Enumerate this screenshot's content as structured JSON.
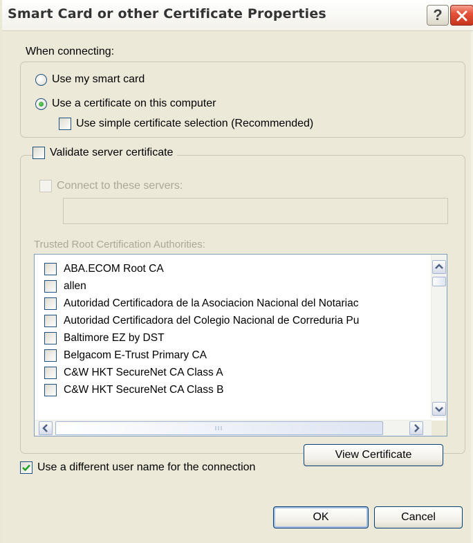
{
  "window": {
    "title": "Smart Card or other Certificate Properties",
    "help_label": "?"
  },
  "when_connecting": {
    "legend": "When connecting:",
    "use_smart_card": {
      "label": "Use my smart card",
      "selected": false
    },
    "use_certificate": {
      "label": "Use a certificate on this computer",
      "selected": true
    },
    "simple_selection": {
      "label": "Use simple certificate selection (Recommended)",
      "checked": false
    }
  },
  "validate": {
    "label": "Validate server certificate",
    "checked": false,
    "connect_servers": {
      "label": "Connect to these servers:",
      "checked": false,
      "enabled": false,
      "value": ""
    },
    "trusted_root_label": "Trusted Root Certification Authorities:",
    "authorities": [
      {
        "name": "ABA.ECOM Root CA",
        "checked": false
      },
      {
        "name": "allen",
        "checked": false
      },
      {
        "name": "Autoridad Certificadora de la Asociacion Nacional del Notariac",
        "checked": false
      },
      {
        "name": "Autoridad Certificadora del Colegio Nacional de Correduria Pu",
        "checked": false
      },
      {
        "name": "Baltimore EZ by DST",
        "checked": false
      },
      {
        "name": "Belgacom E-Trust Primary CA",
        "checked": false
      },
      {
        "name": "C&W HKT SecureNet CA Class A",
        "checked": false
      },
      {
        "name": "C&W HKT SecureNet CA Class B",
        "checked": false
      }
    ],
    "view_certificate_label": "View Certificate"
  },
  "different_user": {
    "label": "Use a different user name for the connection",
    "checked": true
  },
  "buttons": {
    "ok": "OK",
    "cancel": "Cancel"
  }
}
